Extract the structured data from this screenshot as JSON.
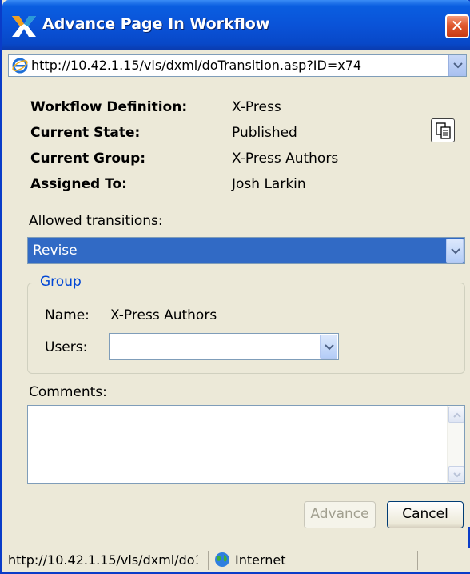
{
  "window": {
    "title": "Advance Page In Workflow",
    "close_glyph": "✕"
  },
  "address": {
    "url": "http://10.42.1.15/vls/dxml/doTransition.asp?ID=x74"
  },
  "details": {
    "workflow_label": "Workflow Definition:",
    "workflow_value": "X-Press",
    "state_label": "Current State:",
    "state_value": "Published",
    "group_label": "Current Group:",
    "group_value": "X-Press Authors",
    "assigned_label": "Assigned To:",
    "assigned_value": "Josh Larkin"
  },
  "transitions": {
    "label": "Allowed transitions:",
    "selected": "Revise"
  },
  "group": {
    "legend": "Group",
    "name_label": "Name:",
    "name_value": "X-Press Authors",
    "users_label": "Users:",
    "users_selected": ""
  },
  "comments": {
    "label": "Comments:",
    "value": ""
  },
  "buttons": {
    "advance": "Advance",
    "cancel": "Cancel"
  },
  "status": {
    "url": "http://10.42.1.15/vls/dxml/do1",
    "zone": "Internet"
  },
  "icons": {
    "app": "x-logo-icon",
    "ie": "ie-icon",
    "copy": "copy-icon",
    "globe": "globe-icon"
  },
  "colors": {
    "titlebar": "#0a53d8",
    "selection": "#316ac5",
    "group_legend": "#0046d5",
    "close": "#e0582e"
  }
}
